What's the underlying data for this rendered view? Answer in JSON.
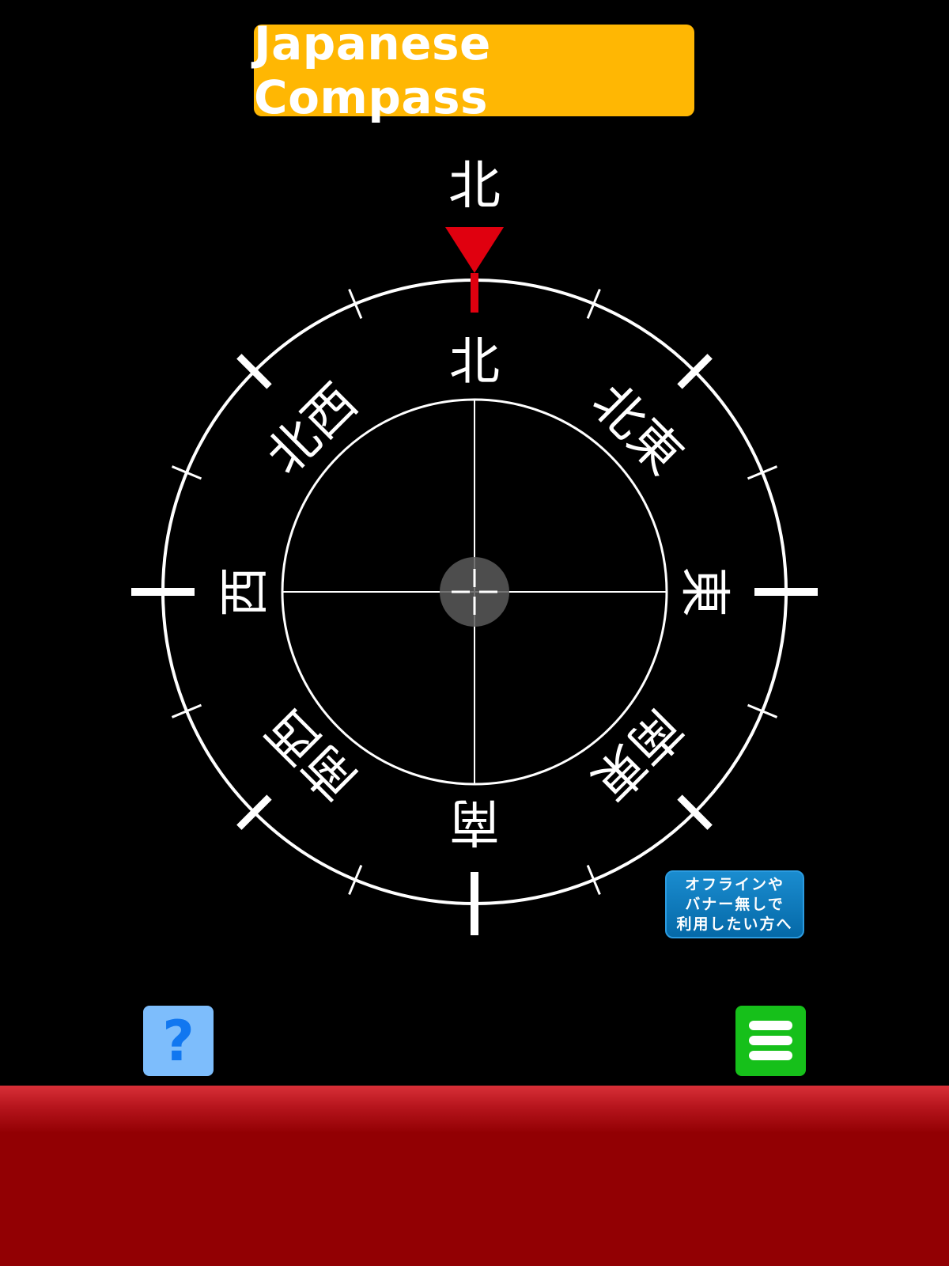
{
  "app": {
    "title": "Japanese Compass"
  },
  "heading_indicator": {
    "label": "北",
    "heading_degrees": 0,
    "pointer_color": "#e0000f"
  },
  "compass": {
    "directions": [
      {
        "key": "n",
        "label": "北",
        "bearing": 0
      },
      {
        "key": "ne",
        "label": "北東",
        "bearing": 45
      },
      {
        "key": "e",
        "label": "東",
        "bearing": 90
      },
      {
        "key": "se",
        "label": "南東",
        "bearing": 135
      },
      {
        "key": "s",
        "label": "南",
        "bearing": 180
      },
      {
        "key": "sw",
        "label": "南西",
        "bearing": 225
      },
      {
        "key": "w",
        "label": "西",
        "bearing": 270
      },
      {
        "key": "nw",
        "label": "北西",
        "bearing": 315
      }
    ],
    "ring_color": "#ffffff",
    "background_color": "#000000"
  },
  "promo": {
    "lines": [
      "オフラインや",
      "バナー無しで",
      "利用したい方へ"
    ],
    "color": "#0a78bd"
  },
  "toolbar": {
    "help_icon": "question-mark-icon",
    "help_glyph": "?",
    "help_color": "#7dbdfc",
    "menu_icon": "hamburger-menu-icon",
    "menu_color": "#16c01a"
  },
  "bottom_panel": {
    "color": "#920003"
  }
}
